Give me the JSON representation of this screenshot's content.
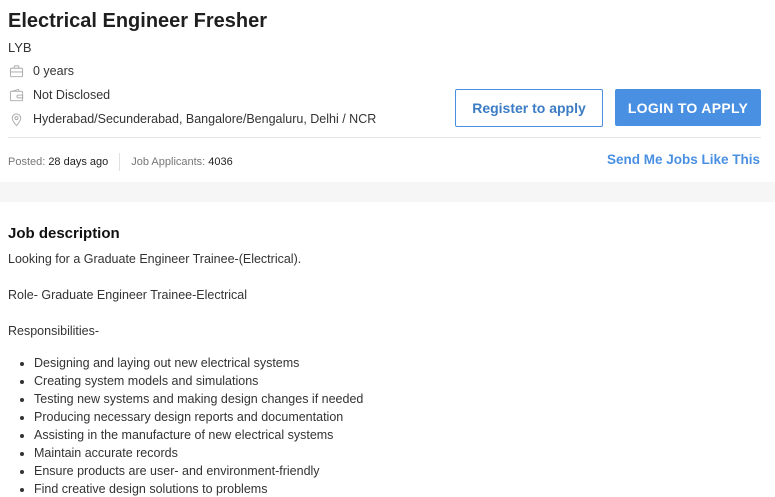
{
  "job": {
    "title": "Electrical Engineer Fresher",
    "company": "LYB",
    "experience": "0 years",
    "salary": "Not Disclosed",
    "location": "Hyderabad/Secunderabad, Bangalore/Bengaluru, Delhi / NCR"
  },
  "icons": {
    "experience": "briefcase-icon",
    "salary": "wallet-icon",
    "location": "location-pin-icon"
  },
  "actions": {
    "register_label": "Register to apply",
    "login_label": "LOGIN TO APPLY",
    "send_me_label": "Send Me Jobs Like This"
  },
  "stats": {
    "posted_label": "Posted:",
    "posted_value": "28 days ago",
    "applicants_label": "Job Applicants:",
    "applicants_value": "4036"
  },
  "description": {
    "heading": "Job description",
    "intro": "Looking for a Graduate Engineer Trainee-(Electrical).",
    "role": "Role- Graduate Engineer Trainee-Electrical",
    "responsibilities_label": "Responsibilities-",
    "responsibilities": [
      "Designing and laying out new electrical systems",
      "Creating system models and simulations",
      "Testing new systems and making design changes if needed",
      "Producing necessary design reports and documentation",
      "Assisting in the manufacture of new electrical systems",
      "Maintain accurate records",
      "Ensure products are user- and environment-friendly",
      "Find creative design solutions to problems"
    ]
  },
  "colors": {
    "accent": "#4a90e2",
    "page_band": "#f6f6f6"
  }
}
